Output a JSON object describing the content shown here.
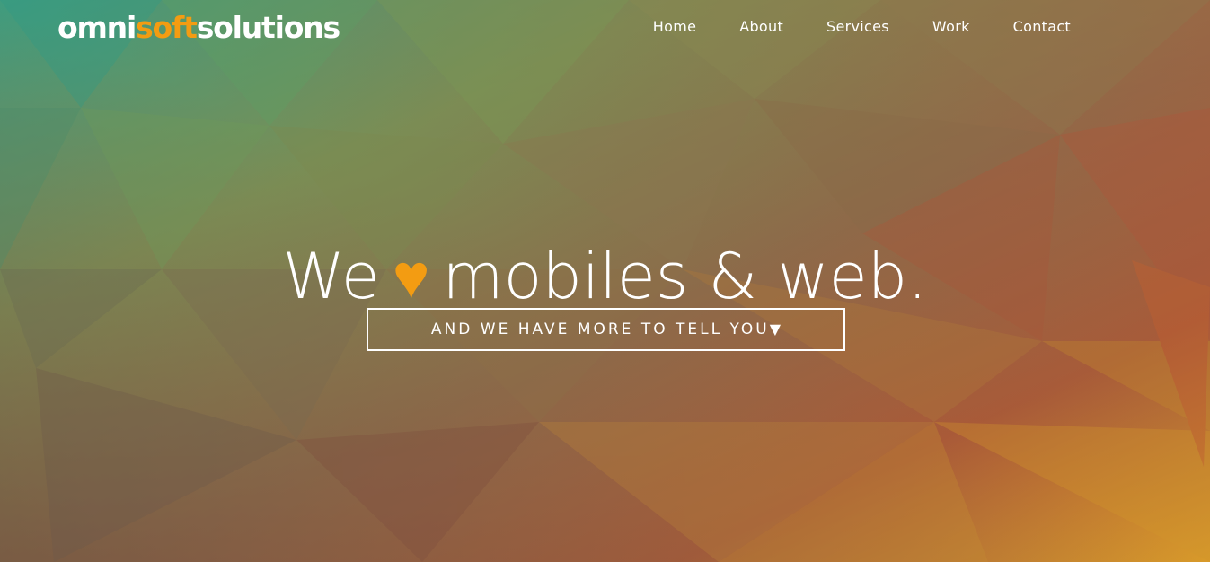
{
  "brand": {
    "part1": "omni",
    "part2": "soft",
    "part3": "solutions",
    "accent_color": "#f39c12"
  },
  "nav": {
    "items": [
      {
        "label": "Home"
      },
      {
        "label": "About"
      },
      {
        "label": "Services"
      },
      {
        "label": "Work"
      },
      {
        "label": "Contact"
      }
    ]
  },
  "hero": {
    "headline_before": "We",
    "heart_glyph": "♥",
    "headline_after": "mobiles & web.",
    "cta_label": "AND WE HAVE MORE TO TELL YOU",
    "cta_arrow": "▼"
  },
  "theme": {
    "gradient_colors": [
      "#4a9e7a",
      "#7d8b55",
      "#8f6a4a",
      "#a5523a",
      "#d69a2a"
    ]
  }
}
